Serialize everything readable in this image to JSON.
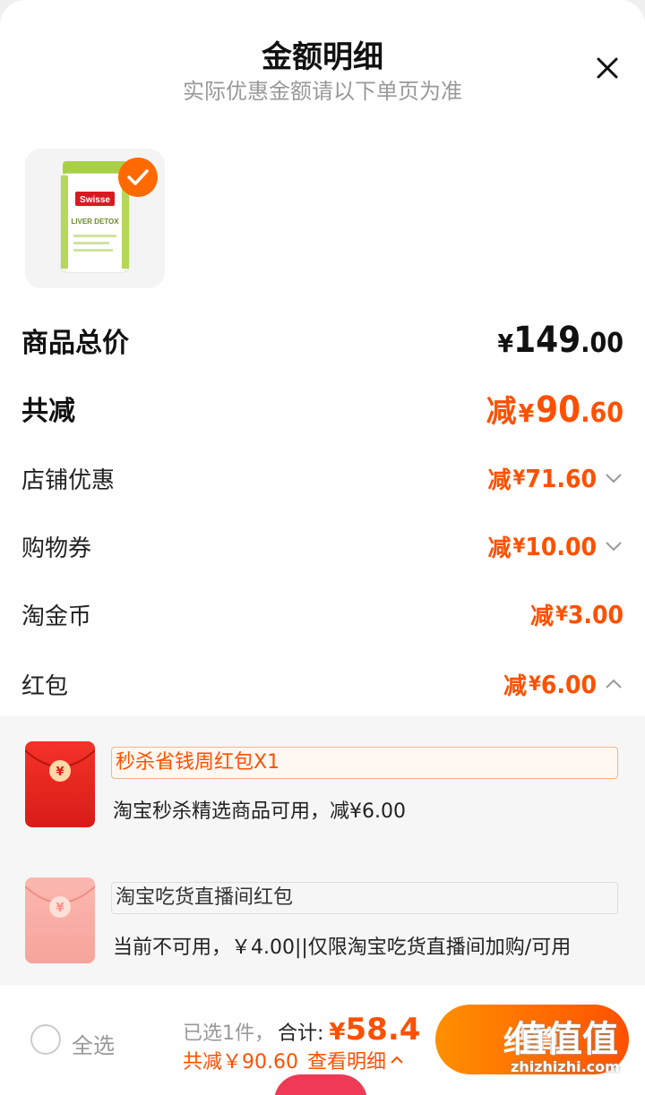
{
  "header": {
    "title": "金额明细",
    "subtitle": "实际优惠金额请以下单页为准"
  },
  "product": {
    "brand": "Swisse",
    "name": "LIVER DETOX",
    "selected": true
  },
  "summary": {
    "total_label": "商品总价",
    "total_currency": "¥",
    "total_int": "149",
    "total_dec": ".00",
    "discount_label": "共减",
    "discount_prefix": "减",
    "discount_currency": "¥",
    "discount_int": "90",
    "discount_dec": ".60"
  },
  "discounts": [
    {
      "label": "店铺优惠",
      "prefix": "减",
      "currency": "¥",
      "int": "71",
      "dec": ".60"
    },
    {
      "label": "购物券",
      "prefix": "减",
      "currency": "¥",
      "int": "10",
      "dec": ".00"
    },
    {
      "label": "淘金币",
      "prefix": "减",
      "currency": "¥",
      "int": "3",
      "dec": ".00"
    },
    {
      "label": "红包",
      "prefix": "减",
      "currency": "¥",
      "int": "6",
      "dec": ".00"
    }
  ],
  "coupons": [
    {
      "name": "秒杀省钱周红包X1",
      "desc": "淘宝秒杀精选商品可用，减¥6.00",
      "available": true
    },
    {
      "name": "淘宝吃货直播间红包",
      "desc": "当前不可用，￥4.00||仅限淘宝吃货直播间加购/可用",
      "available": false
    }
  ],
  "bottom": {
    "select_all": "全选",
    "selected_count": "已选1件，",
    "total_label": "合计:",
    "total_currency": "¥",
    "total_value": "58.4",
    "discount_text": "共减￥90.60",
    "detail_link": "查看明细",
    "checkout": "结算"
  },
  "watermark": {
    "text": "值值值",
    "url": "zhizhizhi.com"
  },
  "colors": {
    "accent": "#ff5000",
    "accent_light": "#ff9000",
    "red_envelope": "#e3261e"
  }
}
